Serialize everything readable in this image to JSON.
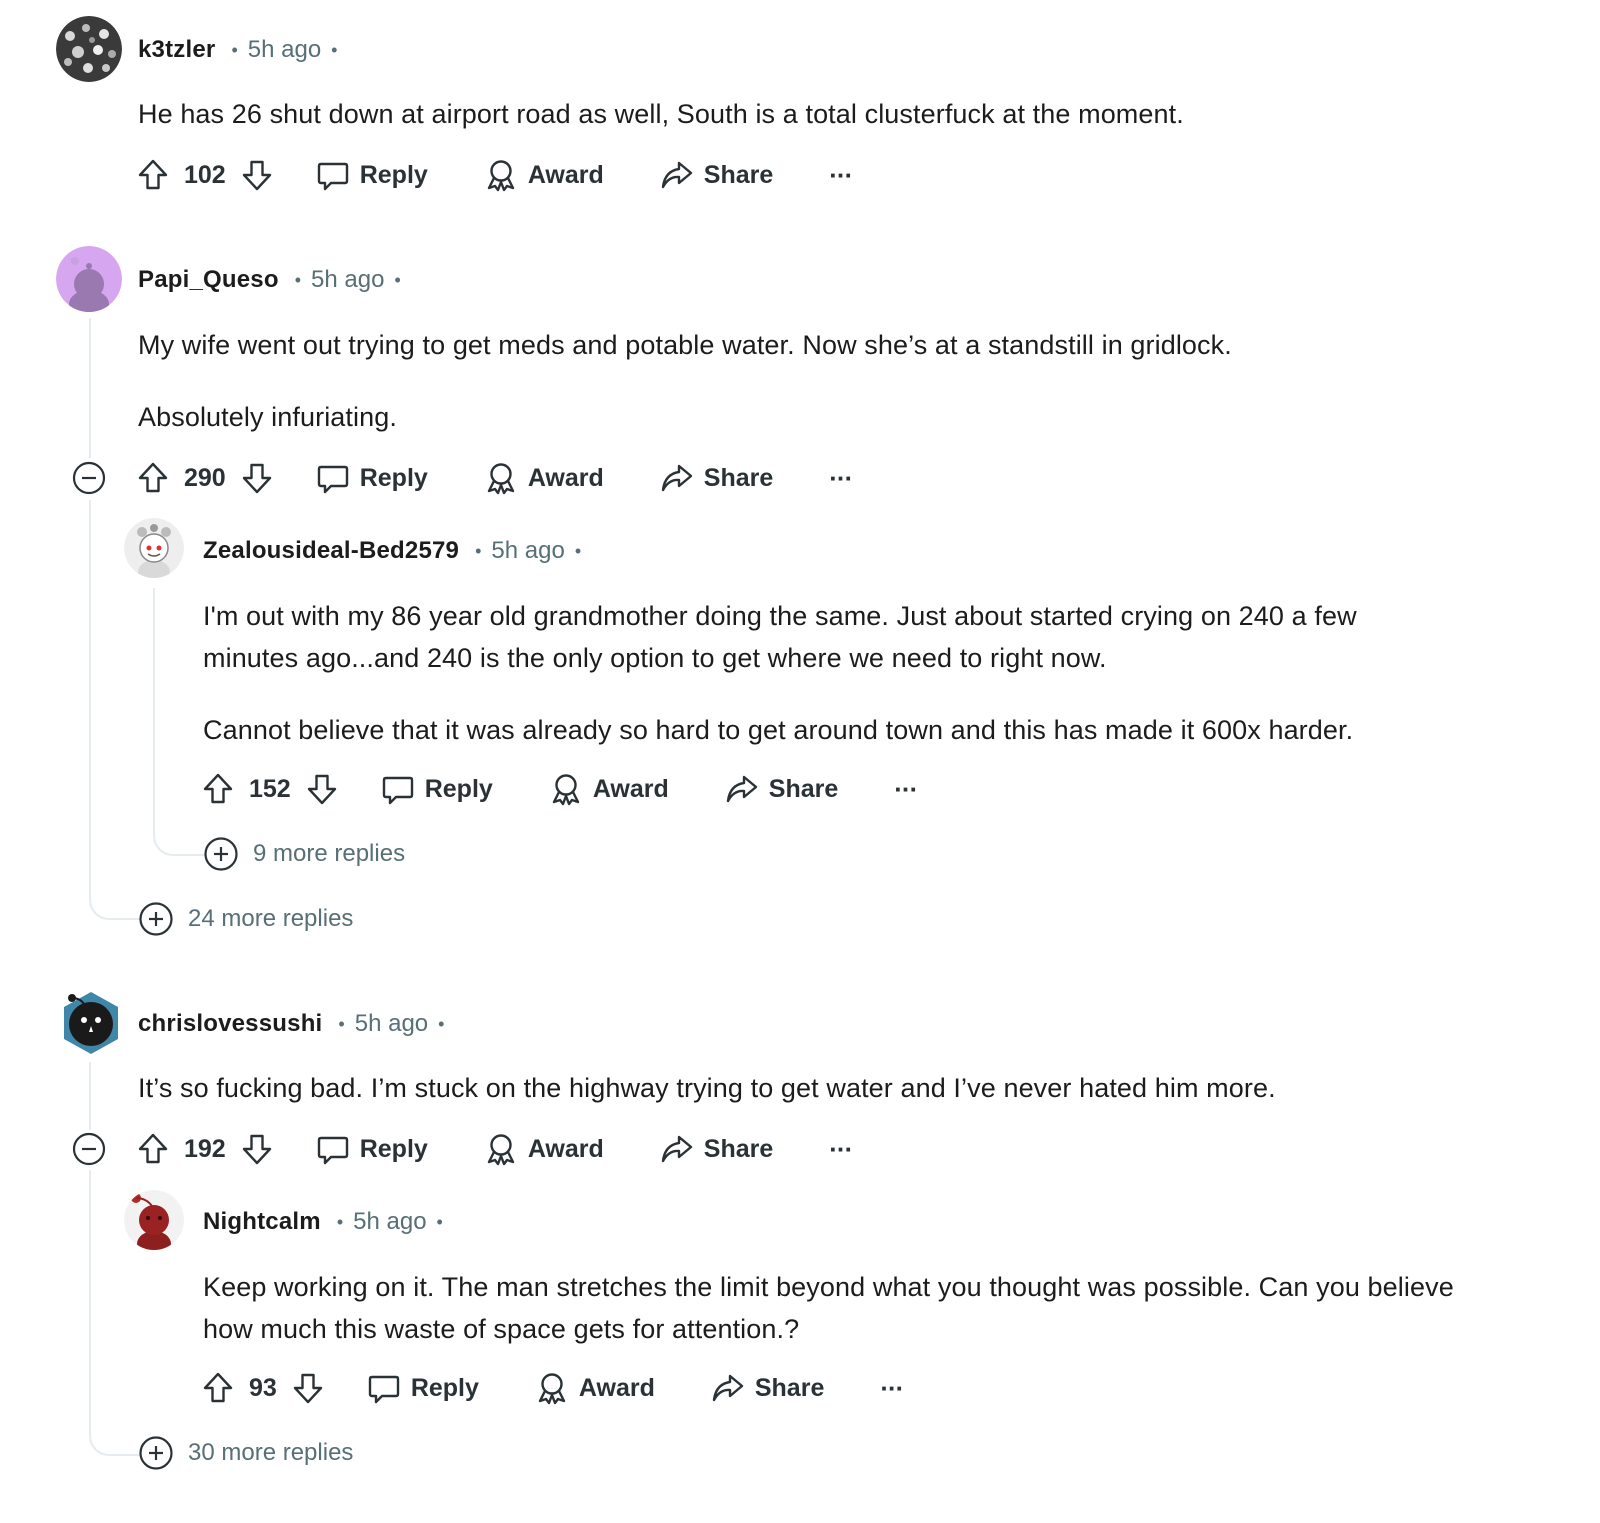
{
  "comments": [
    {
      "username": "k3tzler",
      "time": "5h ago",
      "body": [
        "He has 26 shut down at airport road as well, South is a total clusterfuck at the moment."
      ],
      "votes": "102"
    },
    {
      "username": "Papi_Queso",
      "time": "5h ago",
      "body": [
        "My wife went out trying to get meds and potable water. Now she’s at a standstill in gridlock.",
        "Absolutely infuriating."
      ],
      "votes": "290",
      "more_replies": "24 more replies"
    },
    {
      "username": "Zealousideal-Bed2579",
      "time": "5h ago",
      "body": [
        "I'm out with my 86 year old grandmother doing the same. Just about started crying on 240 a few",
        "minutes ago...and 240 is the only option to get where we need to right now.",
        "Cannot believe that it was already so hard to get around town and this has made it 600x harder."
      ],
      "votes": "152",
      "more_replies": "9 more replies"
    },
    {
      "username": "chrislovessushi",
      "time": "5h ago",
      "body": [
        "It’s so fucking bad. I’m stuck on the highway trying to get water and I’ve never hated him more."
      ],
      "votes": "192",
      "more_replies": "30 more replies"
    },
    {
      "username": "Nightcalm",
      "time": "5h ago",
      "body": [
        "Keep working on it. The man stretches the limit beyond what you thought was possible. Can you believe",
        "how much this waste of space gets for attention.?"
      ],
      "votes": "93"
    }
  ],
  "labels": {
    "reply": "Reply",
    "award": "Award",
    "share": "Share",
    "more": "···"
  },
  "icons": [
    "upvote-icon",
    "downvote-icon",
    "reply-icon",
    "award-icon",
    "share-icon",
    "collapse-icon",
    "expand-icon"
  ],
  "colors": {
    "text": "#1c1c1c",
    "meta": "#576f76",
    "thread_line": "#e5ebee"
  }
}
